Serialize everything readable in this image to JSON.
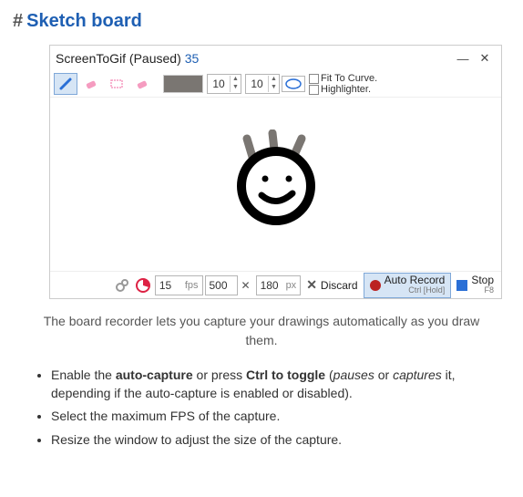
{
  "heading": "Sketch board",
  "window": {
    "title": "ScreenToGif (Paused)",
    "frame_count": "35",
    "minimize": "—",
    "close": "✕"
  },
  "toolbar": {
    "pen": "pen",
    "eraser1": "eraser",
    "rect": "rect",
    "eraser2": "eraser",
    "size1": "10",
    "size2": "10",
    "fit_to_curve": "Fit To Curve.",
    "highlighter": "Highlighter."
  },
  "bottom": {
    "fps_value": "15",
    "fps_unit": "fps",
    "width": "500",
    "height": "180",
    "px": "px",
    "times": "✕",
    "discard": "Discard",
    "auto_record": "Auto Record",
    "auto_sub": "Ctrl [Hold]",
    "stop": "Stop",
    "stop_sub": "F8"
  },
  "caption": "The board recorder lets you capture your drawings automatically as you draw them.",
  "tips": {
    "t1a": "Enable the ",
    "t1b": "auto-capture",
    "t1c": " or press ",
    "t1d": "Ctrl to toggle",
    "t1e": " (",
    "t1f": "pauses",
    "t1g": " or ",
    "t1h": "captures",
    "t1i": " it, depending if the auto-capture is enabled or disabled).",
    "t2": "Select the maximum FPS of the capture.",
    "t3": "Resize the window to adjust the size of the capture."
  }
}
